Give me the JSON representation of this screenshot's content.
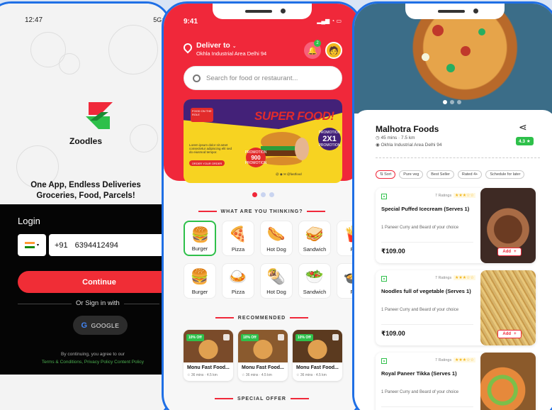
{
  "colors": {
    "accent": "#f0283a",
    "green": "#2ec04a",
    "frame": "#1f6fe5"
  },
  "login": {
    "status_time": "12:47",
    "status_icons": "5G⁺ ",
    "brand": "Zoodles",
    "tagline1": "One App, Endless Deliveries",
    "tagline2": "Groceries, Food, Parcels!",
    "title": "Login",
    "country_code": "+91",
    "phone_number": "6394412494",
    "continue_label": "Continue",
    "or_sign_in": "Or Sign in with",
    "google_label": "GOOGLE",
    "terms_prefix": "By continuing, you agree to our",
    "terms_links": "Terms & Conditions, Privacy Policy Content Policy"
  },
  "home": {
    "status_time": "9:41",
    "status_icons": "▂▄▆ ◔ ▭",
    "deliver_to": "Deliver to",
    "address": "Okhla Industrial Area Delhi 94",
    "notification_count": "2",
    "search_placeholder": "Search for food or restaurant...",
    "banner": {
      "badge": "FOOD ON THE ROLE",
      "title": "SUPER FOOD!",
      "text": "Lorem ipsum dolor sit amet consectetur adipiscing elit sed do eiusmod tempor.",
      "order_label": "ORDER YOUR ORDER",
      "promo_price_top": "PROMOTION",
      "promo_price": "900",
      "promo_price_bottom": "PROMOTION",
      "promo_deal_top": "PROMOTION",
      "promo_deal": "2X1",
      "promo_deal_bottom": "PROMOTION",
      "social": "@ ◉ ✉ @fastfood"
    },
    "section_categories": "WHAT ARE YOU THINKING?",
    "categories": [
      {
        "label": "Burger",
        "icon": "burger-icon",
        "glyph": "🍔",
        "selected": true
      },
      {
        "label": "Pizza",
        "icon": "pizza-icon",
        "glyph": "🍕",
        "selected": false
      },
      {
        "label": "Hot Dog",
        "icon": "hotdog-icon",
        "glyph": "🌭",
        "selected": false
      },
      {
        "label": "Sandwich",
        "icon": "sandwich-icon",
        "glyph": "🥪",
        "selected": false
      },
      {
        "label": "Fr",
        "icon": "fries-icon",
        "glyph": "🍟",
        "selected": false
      },
      {
        "label": "Burger",
        "icon": "burger-icon",
        "glyph": "🍔",
        "selected": false
      },
      {
        "label": "Pizza",
        "icon": "curry-icon",
        "glyph": "🍛",
        "selected": false
      },
      {
        "label": "Hot Dog",
        "icon": "wrap-icon",
        "glyph": "🌯",
        "selected": false
      },
      {
        "label": "Sandwich",
        "icon": "salad-icon",
        "glyph": "🥗",
        "selected": false
      },
      {
        "label": "Fr",
        "icon": "bowl-icon",
        "glyph": "🍲",
        "selected": false
      }
    ],
    "section_recommended": "RECOMMENDED",
    "recommended": [
      {
        "discount": "10% Off",
        "name": "Monu Fast Food...",
        "meta": "☆ 36 mins · 4.5 km"
      },
      {
        "discount": "10% Off",
        "name": "Monu Fast Food...",
        "meta": "☆ 36 mins · 4.5 km"
      },
      {
        "discount": "10% Off",
        "name": "Monu Fast Food...",
        "meta": "☆ 36 mins · 4.5 km"
      }
    ],
    "section_special": "SPECIAL OFFER"
  },
  "restaurant": {
    "name": "Malhotra Foods",
    "meta": "◷ 45 mins · 7.5 km",
    "address": "◉ Okhla Industrial Area Delhi 94",
    "rating": "4.3 ★",
    "chips": [
      "⇅ Sort",
      "Pure veg",
      "Best Seller",
      "Rated 4+",
      "Schedule for later"
    ],
    "items": [
      {
        "ratings": "7 Ratings",
        "stars": "★★★☆☆",
        "name": "Special Puffed Icecream (Serves 1)",
        "desc": "1 Paneer Curry and Beard of your choice",
        "price": "₹109.00",
        "add_label": "Add"
      },
      {
        "ratings": "7 Ratings",
        "stars": "★★★☆☆",
        "name": "Noodles full of vegetable (Serves 1)",
        "desc": "1 Paneer Curry and Beard of your choice",
        "price": "₹109.00",
        "add_label": "Add"
      },
      {
        "ratings": "7 Ratings",
        "stars": "★★★☆☆",
        "name": "Royal Paneer Tikka (Serves 1)",
        "desc": "1 Paneer Curry and Beard of your choice",
        "price": "₹109.00",
        "add_label": "Add"
      }
    ]
  }
}
